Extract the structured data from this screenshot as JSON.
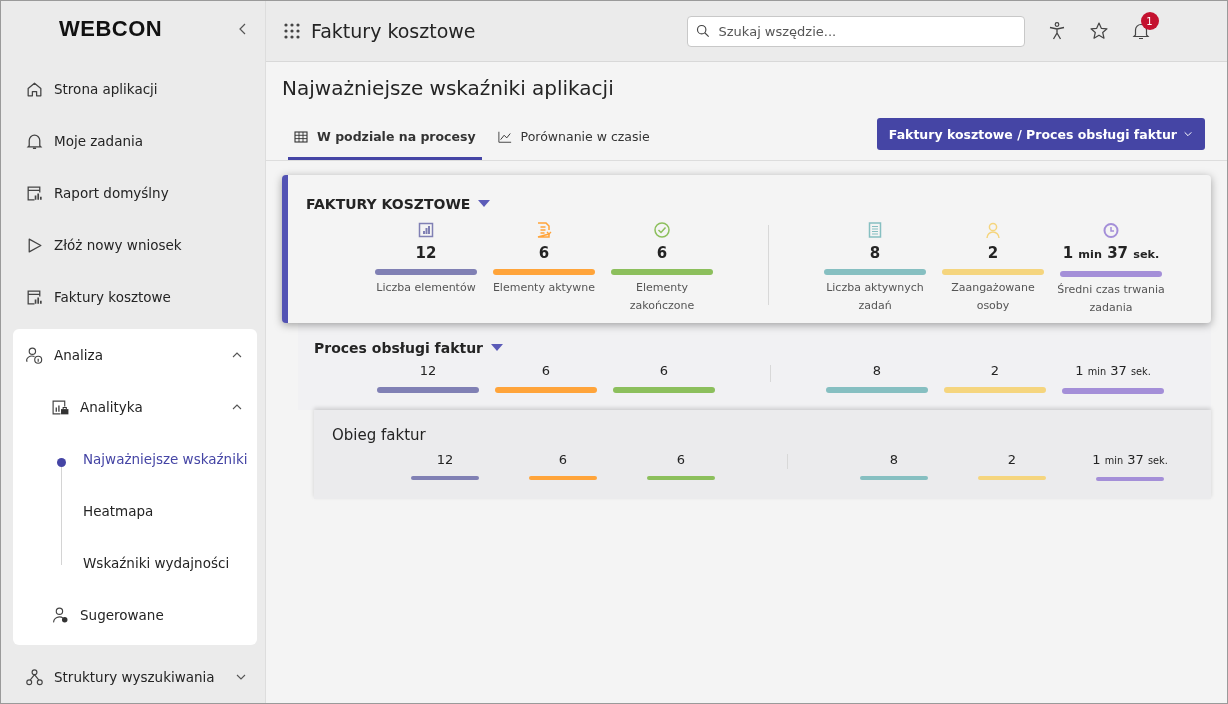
{
  "logo": "WEBCON",
  "sidebar": {
    "items": [
      {
        "label": "Strona aplikacji"
      },
      {
        "label": "Moje zadania"
      },
      {
        "label": "Raport domyślny"
      },
      {
        "label": "Złóż nowy wniosek"
      },
      {
        "label": "Faktury kosztowe"
      },
      {
        "label": "Analiza",
        "expanded": true,
        "children": [
          {
            "label": "Analityka",
            "expanded": true,
            "children": [
              {
                "label": "Najważniejsze wskaźniki",
                "selected": true
              },
              {
                "label": "Heatmapa",
                "selected": false
              },
              {
                "label": "Wskaźniki wydajności",
                "selected": false
              }
            ]
          },
          {
            "label": "Sugerowane"
          }
        ]
      },
      {
        "label": "Struktury wyszukiwania",
        "expanded": false
      }
    ]
  },
  "header": {
    "title": "Faktury kosztowe",
    "search": {
      "placeholder": "Szukaj wszędzie..."
    },
    "notification_count": "1"
  },
  "page": {
    "title": "Najważniejsze wskaźniki aplikacji",
    "tabs": [
      {
        "label": "W podziale na procesy",
        "selected": true
      },
      {
        "label": "Porównanie w czasie",
        "selected": false
      }
    ],
    "filter_button": "Faktury kosztowe / Proces obsługi faktur"
  },
  "metrics": [
    {
      "label": "Liczba elementów",
      "color": "#8080b4"
    },
    {
      "label": "Elementy aktywne",
      "color": "#ffa43a"
    },
    {
      "label": "Elementy zakończone",
      "color": "#8cbf5c"
    },
    {
      "label": "Liczba aktywnych zadań",
      "color": "#86bfc1"
    },
    {
      "label": "Zaangażowane osoby",
      "color": "#f5d57e"
    },
    {
      "label": "Średni czas trwania zadania",
      "color": "#a48fd8"
    }
  ],
  "groups": [
    {
      "title": "FAKTURY KOSZTOWE",
      "kind": "application",
      "has_dropdown": true,
      "values": [
        [
          {
            "text": "12",
            "kind": "number"
          }
        ],
        [
          {
            "text": "6",
            "kind": "number"
          }
        ],
        [
          {
            "text": "6",
            "kind": "number"
          }
        ],
        [
          {
            "text": "8",
            "kind": "number"
          }
        ],
        [
          {
            "text": "2",
            "kind": "number"
          }
        ],
        [
          {
            "text": "1",
            "kind": "number"
          },
          {
            "text": "min",
            "kind": "unit"
          },
          {
            "text": "37",
            "kind": "number"
          },
          {
            "text": "sek.",
            "kind": "unit"
          }
        ]
      ]
    },
    {
      "title": "Proces obsługi faktur",
      "kind": "process",
      "has_dropdown": true,
      "values": [
        [
          {
            "text": "12",
            "kind": "number"
          }
        ],
        [
          {
            "text": "6",
            "kind": "number"
          }
        ],
        [
          {
            "text": "6",
            "kind": "number"
          }
        ],
        [
          {
            "text": "8",
            "kind": "number"
          }
        ],
        [
          {
            "text": "2",
            "kind": "number"
          }
        ],
        [
          {
            "text": "1",
            "kind": "number"
          },
          {
            "text": "min",
            "kind": "unit"
          },
          {
            "text": "37",
            "kind": "number"
          },
          {
            "text": "sek.",
            "kind": "unit"
          }
        ]
      ]
    },
    {
      "title": "Obieg faktur",
      "kind": "workflow",
      "has_dropdown": false,
      "values": [
        [
          {
            "text": "12",
            "kind": "number"
          }
        ],
        [
          {
            "text": "6",
            "kind": "number"
          }
        ],
        [
          {
            "text": "6",
            "kind": "number"
          }
        ],
        [
          {
            "text": "8",
            "kind": "number"
          }
        ],
        [
          {
            "text": "2",
            "kind": "number"
          }
        ],
        [
          {
            "text": "1",
            "kind": "number"
          },
          {
            "text": "min",
            "kind": "unit"
          },
          {
            "text": "37",
            "kind": "number"
          },
          {
            "text": "sek.",
            "kind": "unit"
          }
        ]
      ]
    }
  ]
}
